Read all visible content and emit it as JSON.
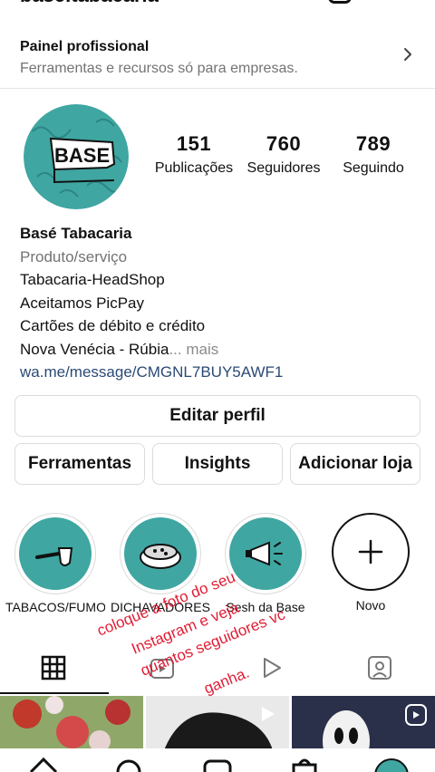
{
  "header": {
    "username": "base.tabacaria"
  },
  "panel": {
    "title": "Painel profissional",
    "subtitle": "Ferramentas e recursos só para empresas."
  },
  "stats": [
    {
      "value": "151",
      "label": "Publicações"
    },
    {
      "value": "760",
      "label": "Seguidores"
    },
    {
      "value": "789",
      "label": "Seguindo"
    }
  ],
  "profile": {
    "avatar_text": "BASE",
    "name": "Basé Tabacaria",
    "category": "Produto/serviço",
    "bio_lines": [
      "Tabacaria-HeadShop",
      "Aceitamos PicPay",
      "Cartões de débito e crédito"
    ],
    "location": "Nova Venécia - Rúbia",
    "more": "... mais",
    "link": "wa.me/message/CMGNL7BUY5AWF1"
  },
  "buttons": {
    "edit": "Editar perfil",
    "tools": "Ferramentas",
    "insights": "Insights",
    "add": "Adicionar loja"
  },
  "highlights": [
    {
      "label": "TABACOS/FUMOS",
      "icon": "pipe-icon"
    },
    {
      "label": "DICHAVADORES",
      "icon": "grinder-icon"
    },
    {
      "label": "Sesh da Base",
      "icon": "megaphone-icon"
    },
    {
      "label": "Novo",
      "icon": "plus-icon"
    }
  ],
  "overlay_text": [
    "coloque a foto do seu",
    "Instagram e veja",
    "quantos seguidores vc",
    "ganha."
  ],
  "colors": {
    "accent_teal": "#3fa6a2",
    "overlay_red": "#e0102a",
    "link": "#2b4a75"
  }
}
